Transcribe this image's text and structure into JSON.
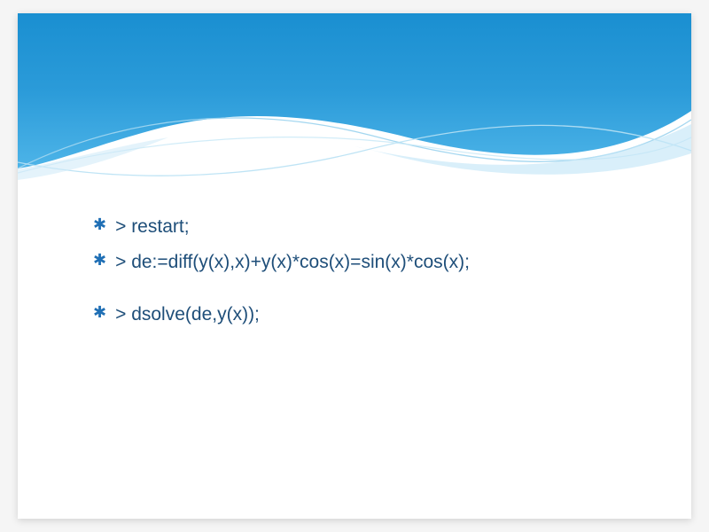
{
  "slide": {
    "items": [
      {
        "text": "> restart;"
      },
      {
        "text": "> de:=diff(y(x),x)+y(x)*cos(x)=sin(x)*cos(x);"
      },
      {
        "text": "> dsolve(de,y(x));"
      }
    ]
  }
}
